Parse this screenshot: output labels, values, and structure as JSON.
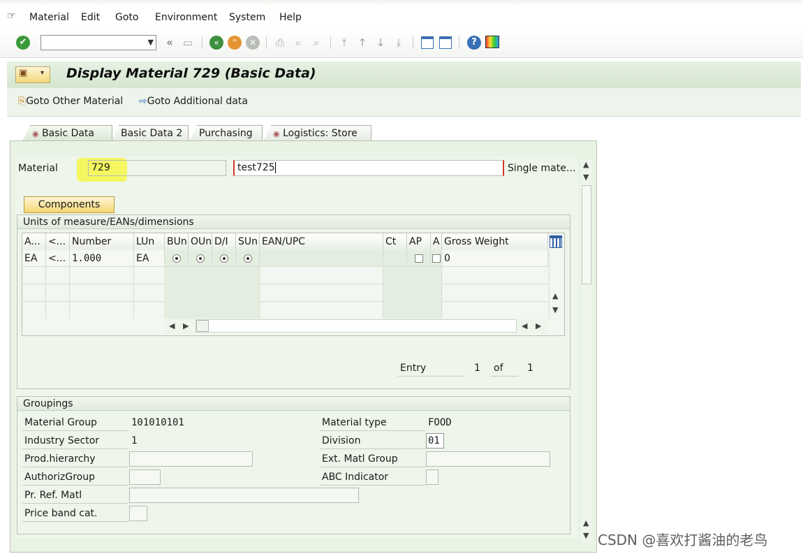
{
  "menu": {
    "items": [
      {
        "label": "Material"
      },
      {
        "label": "Edit"
      },
      {
        "label": "Goto"
      },
      {
        "label": "Environment"
      },
      {
        "label": "System"
      },
      {
        "label": "Help"
      }
    ]
  },
  "toolbar": {
    "command_value": "",
    "icons": [
      "enter-icon",
      "save-icon",
      "back-icon",
      "exit-icon",
      "cancel-icon",
      "print-icon",
      "find-icon",
      "find-next-icon",
      "first-page-icon",
      "previous-page-icon",
      "next-page-icon",
      "last-page-icon",
      "create-session-icon",
      "shortcut-icon",
      "help-icon",
      "customize-layout-icon"
    ]
  },
  "header": {
    "title": "Display Material 729 (Basic Data)",
    "actions": {
      "goto_other": "Goto Other Material",
      "goto_additional": "Goto Additional data"
    }
  },
  "tabs": [
    {
      "label": "Basic Data",
      "active": true
    },
    {
      "label": "Basic Data 2",
      "active": false
    },
    {
      "label": "Purchasing",
      "active": false
    },
    {
      "label": "Logistics: Store",
      "active": false
    }
  ],
  "material": {
    "label": "Material",
    "number": "729",
    "description": "test725",
    "type_text": "Single mate…"
  },
  "components_button": "Components",
  "uom": {
    "title": "Units of measure/EANs/dimensions",
    "columns": [
      "A...",
      "<...",
      "Number",
      "LUn",
      "BUn",
      "OUn",
      "D/I",
      "SUn",
      "EAN/UPC",
      "Ct",
      "AP",
      "A",
      "Gross Weight"
    ],
    "rows": [
      {
        "a": "EA",
        "b": "<...",
        "number": "1.000",
        "lun": "EA",
        "gross_weight": "0"
      }
    ],
    "entry_label": "Entry",
    "entry_current": "1",
    "entry_of": "of",
    "entry_total": "1"
  },
  "groupings": {
    "title": "Groupings",
    "material_group_label": "Material Group",
    "material_group": "101010101",
    "industry_sector_label": "Industry Sector",
    "industry_sector": "1",
    "prod_hierarchy_label": "Prod.hierarchy",
    "prod_hierarchy": "",
    "authoriz_group_label": "AuthorizGroup",
    "authoriz_group": "",
    "pr_ref_matl_label": "Pr. Ref. Matl",
    "pr_ref_matl": "",
    "price_band_label": "Price band cat.",
    "price_band": "",
    "material_type_label": "Material type",
    "material_type": "FOOD",
    "division_label": "Division",
    "division": "01",
    "ext_matl_group_label": "Ext. Matl Group",
    "ext_matl_group": "",
    "abc_indicator_label": "ABC Indicator",
    "abc_indicator": ""
  },
  "watermark": "CSDN @喜欢打酱油的老鸟",
  "colors": {
    "highlight": "#f4f75a",
    "frame_green": "#e9f3e4",
    "required_red": "#d63b2a"
  }
}
